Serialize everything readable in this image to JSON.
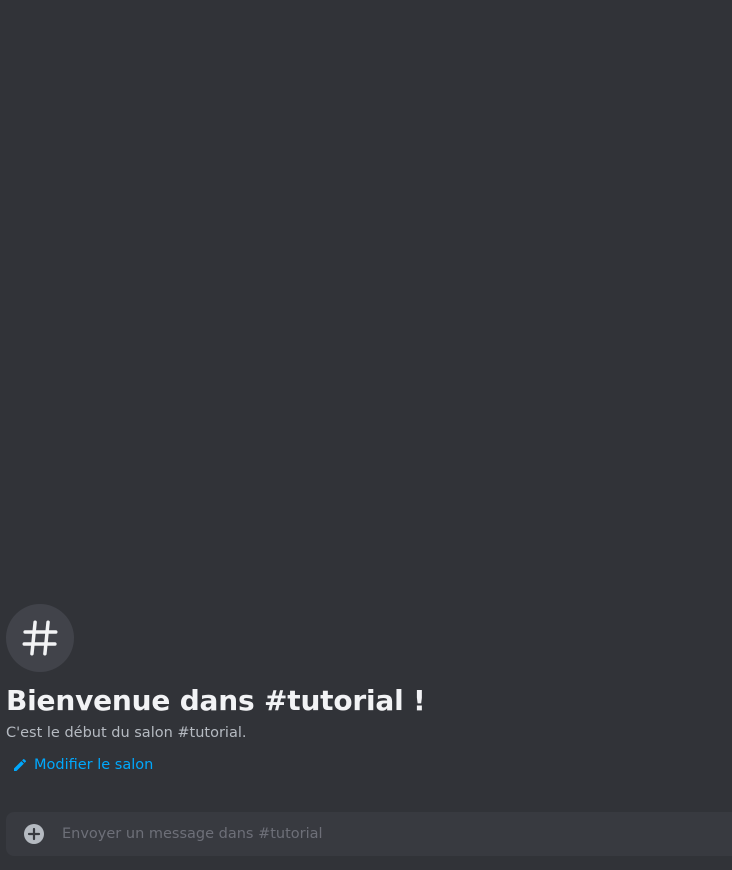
{
  "welcome": {
    "title": "Bienvenue dans #tutorial !",
    "description": "C'est le début du salon #tutorial.",
    "edit_label": "Modifier le salon",
    "avatar_icon": "hashtag-icon"
  },
  "composer": {
    "placeholder": "Envoyer un message dans #tutorial",
    "value": "",
    "attach_icon": "plus-circle-icon"
  },
  "colors": {
    "background": "#313338",
    "avatar_bg": "#41434a",
    "composer_bg": "#383a40",
    "link": "#00a8fc",
    "title": "#f2f3f5",
    "muted": "#b5bac1"
  }
}
